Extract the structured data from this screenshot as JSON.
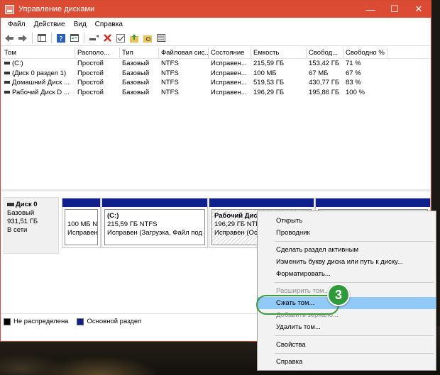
{
  "window": {
    "title": "Управление дисками",
    "controls": {
      "minimize": "—",
      "maximize": "☐",
      "close": "✕"
    }
  },
  "menu": [
    "Файл",
    "Действие",
    "Вид",
    "Справка"
  ],
  "toolbar_icons": [
    "back-arrow-icon",
    "forward-arrow-icon",
    "console-tree-icon",
    "help-icon",
    "properties-icon",
    "connect-icon",
    "delete-icon",
    "check-icon",
    "folder-up-icon",
    "folder-search-icon",
    "list-view-icon"
  ],
  "table": {
    "columns": [
      "Том",
      "Располо...",
      "Тип",
      "Файловая сис...",
      "Состояние",
      "Емкость",
      "Свобод...",
      "Свободно %"
    ],
    "rows": [
      [
        "(C:)",
        "Простой",
        "Базовый",
        "NTFS",
        "Исправен...",
        "215,59 ГБ",
        "153,42 ГБ",
        "71 %"
      ],
      [
        "(Диск 0 раздел 1)",
        "Простой",
        "Базовый",
        "NTFS",
        "Исправен...",
        "100 МБ",
        "67 МБ",
        "67 %"
      ],
      [
        "Домашний Диск ...",
        "Простой",
        "Базовый",
        "NTFS",
        "Исправен...",
        "519,53 ГБ",
        "430,77 ГБ",
        "83 %"
      ],
      [
        "Рабочий Диск D ...",
        "Простой",
        "Базовый",
        "NTFS",
        "Исправен...",
        "196,29 ГБ",
        "195,86 ГБ",
        "100 %"
      ]
    ]
  },
  "disk": {
    "name": "Диск 0",
    "type": "Базовый",
    "size": "931,51 ГБ",
    "status": "В сети"
  },
  "partitions": [
    {
      "name": "",
      "size": "100 МБ N",
      "status": "Исправен"
    },
    {
      "name": "(C:)",
      "size": "215,59 ГБ NTFS",
      "status": "Исправен (Загрузка, Файл под"
    },
    {
      "name": "Рабочий Дис",
      "size": "196,29 ГБ NTF",
      "status": "Исправен (Ос"
    }
  ],
  "legend": [
    {
      "label": "Не распределена",
      "color": "#000000"
    },
    {
      "label": "Основной раздел",
      "color": "#0f1f8c"
    }
  ],
  "context_menu": {
    "items": [
      {
        "label": "Открыть",
        "state": "normal"
      },
      {
        "label": "Проводник",
        "state": "normal"
      },
      {
        "label": "Сделать раздел активным",
        "state": "normal"
      },
      {
        "label": "Изменить букву диска или путь к диску...",
        "state": "normal"
      },
      {
        "label": "Форматировать...",
        "state": "normal"
      },
      {
        "label": "Расширить том...",
        "state": "disabled"
      },
      {
        "label": "Сжать том...",
        "state": "highlighted"
      },
      {
        "label": "Добавить зеркало...",
        "state": "disabled"
      },
      {
        "label": "Удалить том...",
        "state": "normal"
      },
      {
        "label": "Свойства",
        "state": "normal"
      },
      {
        "label": "Справка",
        "state": "normal"
      }
    ]
  },
  "step_badge": "3",
  "colors": {
    "titlebar": "#dc4b33",
    "highlight": "#91c9f7",
    "primary_partition": "#0f1f8c",
    "badge": "#2e9a3a"
  }
}
